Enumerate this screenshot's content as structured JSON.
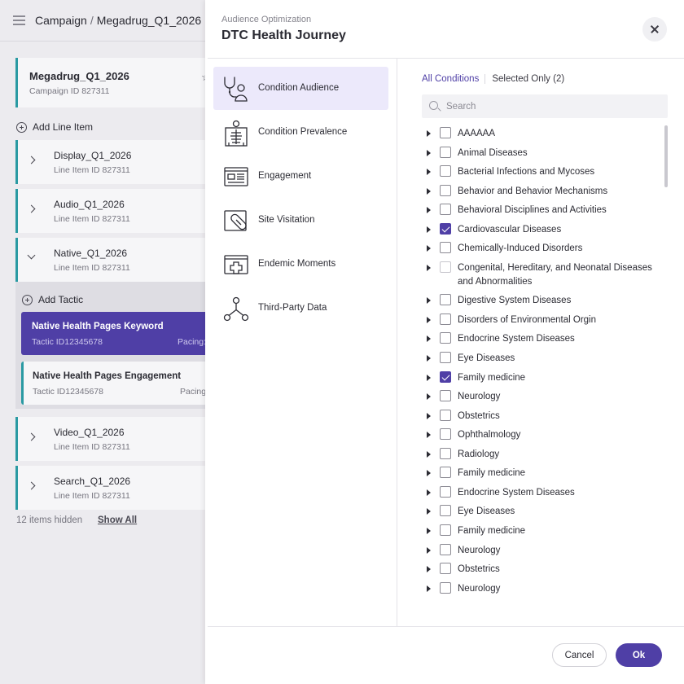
{
  "header": {
    "breadcrumb_root": "Campaign",
    "breadcrumb_separator": "/",
    "breadcrumb_current": "Megadrug_Q1_2026"
  },
  "campaign": {
    "name": "Megadrug_Q1_2026",
    "id_text": "Campaign ID 827311"
  },
  "add_line_item_label": "Add Line Item",
  "line_items": [
    {
      "name": "Display_Q1_2026",
      "id_text": "Line Item ID 827311"
    },
    {
      "name": "Audio_Q1_2026",
      "id_text": "Line Item ID 827311"
    },
    {
      "name": "Native_Q1_2026",
      "id_text": "Line Item ID 827311"
    },
    {
      "name": "Video_Q1_2026",
      "id_text": "Line Item ID 827311"
    },
    {
      "name": "Search_Q1_2026",
      "id_text": "Line Item ID 827311"
    }
  ],
  "add_tactic_label": "Add Tactic",
  "tactics": [
    {
      "name": "Native Health Pages Keyword",
      "id_text": "Tactic ID12345678",
      "pacing": "Pacing:"
    },
    {
      "name": "Native Health Pages Engagement",
      "id_text": "Tactic ID12345678",
      "pacing": "Pacing"
    }
  ],
  "hidden_text": "12 items hidden",
  "show_all_label": "Show All",
  "modal": {
    "eyebrow": "Audience Optimization",
    "title": "DTC Health Journey",
    "categories": [
      {
        "label": "Condition Audience",
        "icon": "stethoscope-user-icon"
      },
      {
        "label": "Condition Prevalence",
        "icon": "xray-person-icon"
      },
      {
        "label": "Engagement",
        "icon": "article-page-icon"
      },
      {
        "label": "Site Visitation",
        "icon": "bandage-icon"
      },
      {
        "label": "Endemic Moments",
        "icon": "medical-cross-icon"
      },
      {
        "label": "Third-Party Data",
        "icon": "network-nodes-icon"
      }
    ],
    "filter_all": "All Conditions",
    "filter_selected": "Selected Only (2)",
    "search_placeholder": "Search",
    "conditions": [
      {
        "label": "AAAAAA",
        "checked": false
      },
      {
        "label": "Animal Diseases",
        "checked": false
      },
      {
        "label": "Bacterial Infections and Mycoses",
        "checked": false
      },
      {
        "label": "Behavior and Behavior Mechanisms",
        "checked": false
      },
      {
        "label": "Behavioral Disciplines and Activities",
        "checked": false
      },
      {
        "label": "Cardiovascular Diseases",
        "checked": true
      },
      {
        "label": "Chemically-Induced Disorders",
        "checked": false
      },
      {
        "label": "Congenital, Hereditary, and Neonatal Diseases and Abnormalities",
        "checked": false
      },
      {
        "label": "Digestive System Diseases",
        "checked": false
      },
      {
        "label": "Disorders of Environmental Orgin",
        "checked": false
      },
      {
        "label": "Endocrine System Diseases",
        "checked": false
      },
      {
        "label": "Eye Diseases",
        "checked": false
      },
      {
        "label": "Family medicine",
        "checked": true
      },
      {
        "label": "Neurology",
        "checked": false
      },
      {
        "label": "Obstetrics",
        "checked": false
      },
      {
        "label": "Ophthalmology",
        "checked": false
      },
      {
        "label": "Radiology",
        "checked": false
      },
      {
        "label": "Family medicine",
        "checked": false
      },
      {
        "label": "Endocrine System Diseases",
        "checked": false
      },
      {
        "label": "Eye Diseases",
        "checked": false
      },
      {
        "label": "Family medicine",
        "checked": false
      },
      {
        "label": "Neurology",
        "checked": false
      },
      {
        "label": "Obstetrics",
        "checked": false
      },
      {
        "label": "Neurology",
        "checked": false
      }
    ],
    "cancel_label": "Cancel",
    "ok_label": "Ok"
  },
  "colors": {
    "accent": "#4f3fa6",
    "teal": "#2a9aa3",
    "active_category_bg": "#ece9fb"
  }
}
